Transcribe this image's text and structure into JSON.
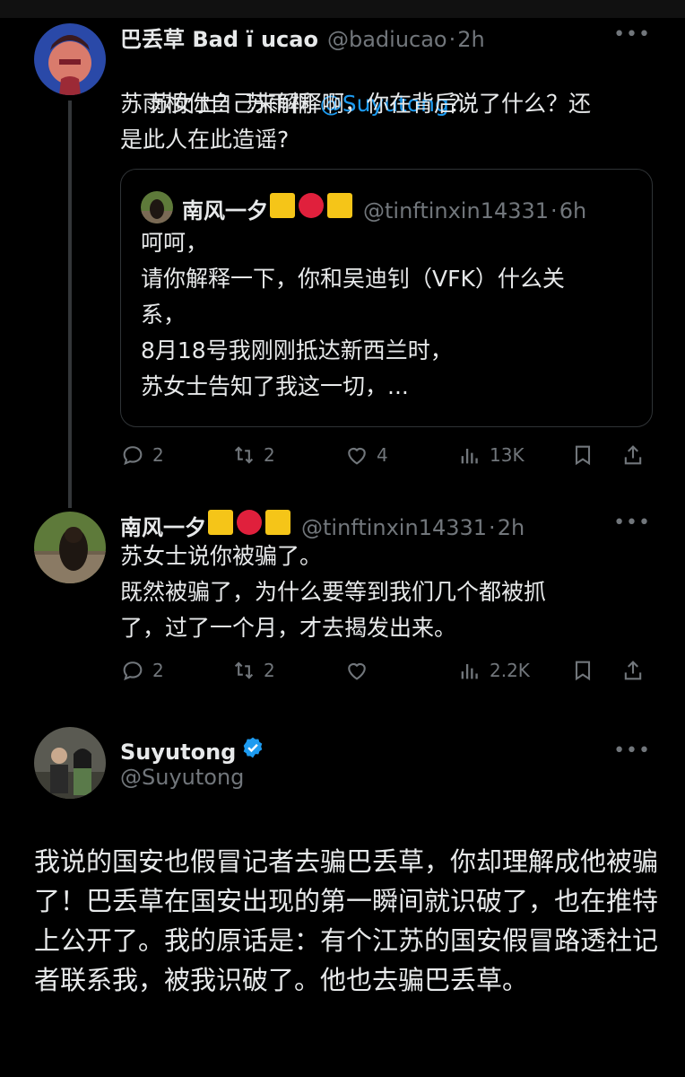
{
  "tweet1": {
    "name": "巴丢草 Bad ï ucao",
    "handle": "@badiucao",
    "dot": "·",
    "time": "2h",
    "text_line1_a": "苏女士？ 苏雨桐 ",
    "text_line1_mention": "@Suyutong",
    "text_line1_b": "？",
    "text_rest": "苏雨桐你自己来解释啊，你在背后说了什么？还\n是此人在此造谣?",
    "quote": {
      "name": "南风一夕",
      "handle": "@tinftinxin14331",
      "dot": "·",
      "time": "6h",
      "text": "呵呵，\n请你解释一下，你和吴迪钊（VFK）什么关\n系，\n8月18号我刚刚抵达新西兰时，\n苏女士告知了我这一切，..."
    },
    "actions": {
      "replies": "2",
      "retweets": "2",
      "likes": "4",
      "views": "13K"
    }
  },
  "tweet2": {
    "name": "南风一夕",
    "handle": "@tinftinxin14331",
    "dot": "·",
    "time": "2h",
    "text": "苏女士说你被骗了。\n既然被骗了，为什么要等到我们几个都被抓\n了，过了一个月，才去揭发出来。",
    "actions": {
      "replies": "2",
      "retweets": "2",
      "likes": "",
      "views": "2.2K"
    }
  },
  "tweet3": {
    "name": "Suyutong",
    "handle": "@Suyutong",
    "text": "我说的国安也假冒记者去骗巴丢草，你却理解成他被骗了！巴丢草在国安出现的第一瞬间就识破了，也在推特上公开了。我的原话是：有个江苏的国安假冒路透社记者联系我，被我识破了。他也去骗巴丢草。"
  },
  "more_label": "•••",
  "colors": {
    "background": "#000000",
    "text": "#e7e9ea",
    "muted": "#71767b",
    "link": "#1d9bf0",
    "verified": "#1d9bf0"
  }
}
